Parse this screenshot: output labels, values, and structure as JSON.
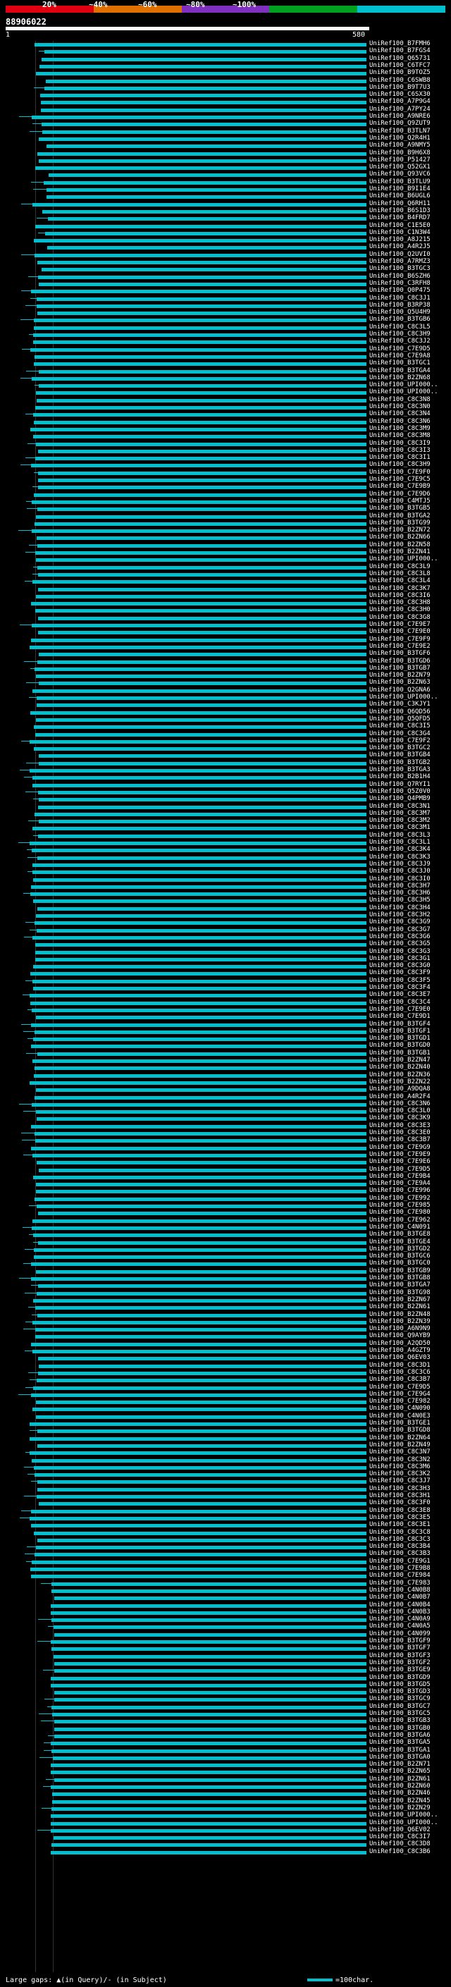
{
  "header": {
    "percent_labels": [
      "20%",
      "~40%",
      "~60%",
      "~80%",
      "~100%"
    ],
    "bar_colors": [
      "#e00010",
      "#e07000",
      "#8030c0",
      "#00a020",
      "#00c0d0"
    ],
    "query_id": "88906022",
    "ruler_start": "1",
    "ruler_end": "580"
  },
  "hits": [
    "UniRef100_B7FMH6",
    "UniRef100_B7FGS4",
    "UniRef100_Q65731",
    "UniRef100_C6TFC7",
    "UniRef100_B9TOZ5",
    "UniRef100_C6SWB8",
    "UniRef100_B9T7U3",
    "UniRef100_C6SX30",
    "UniRef100_A7P9G4",
    "UniRef100_A7PY24",
    "UniRef100_A9NRE6",
    "UniRef100_Q9ZUT9",
    "UniRef100_B3TLN7",
    "UniRef100_Q2R4H1",
    "UniRef100_A9NMY5",
    "UniRef100_B9H6X8",
    "UniRef100_P51427",
    "UniRef100_Q52GX1",
    "UniRef100_Q93VC6",
    "UniRef100_B3TLU9",
    "UniRef100_B9I1E4",
    "UniRef100_B6UGL6",
    "UniRef100_Q6RH11",
    "UniRef100_B6S1D3",
    "UniRef100_B4FRD7",
    "UniRef100_C1E5E0",
    "UniRef100_C1N3W4",
    "UniRef100_A8J215",
    "UniRef100_A4R2J5",
    "UniRef100_Q2UVI0",
    "UniRef100_A7RMZ3",
    "UniRef100_B3TGC3",
    "UniRef100_B6SZH6",
    "UniRef100_C3RFH8",
    "UniRef100_Q0P475",
    "UniRef100_C8C3J1",
    "UniRef100_B3RP38",
    "UniRef100_Q5U4H9",
    "UniRef100_B3TGB6",
    "UniRef100_C8C3L5",
    "UniRef100_C8C3H9",
    "UniRef100_C8C3J2",
    "UniRef100_C7E9D5",
    "UniRef100_C7E9A8",
    "UniRef100_B3TGC1",
    "UniRef100_B3TGA4",
    "UniRef100_B2ZN68",
    "UniRef100_UPI000..",
    "UniRef100_UPI000..",
    "UniRef100_C8C3N8",
    "UniRef100_C8C3N0",
    "UniRef100_C8C3N4",
    "UniRef100_C8C3N6",
    "UniRef100_C8C3M9",
    "UniRef100_C8C3M8",
    "UniRef100_C8C3I9",
    "UniRef100_C8C3I3",
    "UniRef100_C8C3I1",
    "UniRef100_C8C3H9",
    "UniRef100_C7E9F0",
    "UniRef100_C7E9C5",
    "UniRef100_C7E9B9",
    "UniRef100_C7E9D6",
    "UniRef100_C4MTJ5",
    "UniRef100_B3TGB5",
    "UniRef100_B3TGA2",
    "UniRef100_B3TG99",
    "UniRef100_B2ZN72",
    "UniRef100_B2ZN66",
    "UniRef100_B2ZN58",
    "UniRef100_B2ZN41",
    "UniRef100_UPI000..",
    "UniRef100_C8C3L9",
    "UniRef100_C8C3L8",
    "UniRef100_C8C3L4",
    "UniRef100_C8C3K7",
    "UniRef100_C8C3I6",
    "UniRef100_C8C3H8",
    "UniRef100_C8C3H0",
    "UniRef100_C8C3G8",
    "UniRef100_C7E9E7",
    "UniRef100_C7E9E0",
    "UniRef100_C7E9F9",
    "UniRef100_C7E9E2",
    "UniRef100_B3TGF6",
    "UniRef100_B3TGD6",
    "UniRef100_B3TGB7",
    "UniRef100_B2ZN79",
    "UniRef100_B2ZN63",
    "UniRef100_Q2GNA6",
    "UniRef100_UPI000..",
    "UniRef100_C3KJY1",
    "UniRef100_Q6QD56",
    "UniRef100_Q5QFD5",
    "UniRef100_C8C3I5",
    "UniRef100_C8C3G4",
    "UniRef100_C7E9F2",
    "UniRef100_B3TGC2",
    "UniRef100_B3TGB4",
    "UniRef100_B3TGB2",
    "UniRef100_B3TGA3",
    "UniRef100_B2B1H4",
    "UniRef100_Q7RYI1",
    "UniRef100_Q5Z0V0",
    "UniRef100_Q4PMB9",
    "UniRef100_C8C3N1",
    "UniRef100_C8C3M7",
    "UniRef100_C8C3M2",
    "UniRef100_C8C3M1",
    "UniRef100_C8C3L3",
    "UniRef100_C8C3L1",
    "UniRef100_C8C3K4",
    "UniRef100_C8C3K3",
    "UniRef100_C8C3J9",
    "UniRef100_C8C3J0",
    "UniRef100_C8C3I0",
    "UniRef100_C8C3H7",
    "UniRef100_C8C3H6",
    "UniRef100_C8C3H5",
    "UniRef100_C8C3H4",
    "UniRef100_C8C3H2",
    "UniRef100_C8C3G9",
    "UniRef100_C8C3G7",
    "UniRef100_C8C3G6",
    "UniRef100_C8C3G5",
    "UniRef100_C8C3G3",
    "UniRef100_C8C3G1",
    "UniRef100_C8C3G0",
    "UniRef100_C8C3F9",
    "UniRef100_C8C3F5",
    "UniRef100_C8C3F4",
    "UniRef100_C8C3E7",
    "UniRef100_C8C3C4",
    "UniRef100_C7E9E0",
    "UniRef100_C7E9D1",
    "UniRef100_B3TGF4",
    "UniRef100_B3TGF1",
    "UniRef100_B3TGD1",
    "UniRef100_B3TGD0",
    "UniRef100_B3TGB1",
    "UniRef100_B2ZN47",
    "UniRef100_B2ZN40",
    "UniRef100_B2ZN36",
    "UniRef100_B2ZN22",
    "UniRef100_A9DQA8",
    "UniRef100_A4R2F4",
    "UniRef100_C8C3N6",
    "UniRef100_C8C3L0",
    "UniRef100_C8C3K9",
    "UniRef100_C8C3E3",
    "UniRef100_C8C3E0",
    "UniRef100_C8C3B7",
    "UniRef100_C7E9G9",
    "UniRef100_C7E9E9",
    "UniRef100_C7E9E6",
    "UniRef100_C7E9D5",
    "UniRef100_C7E9B4",
    "UniRef100_C7E9A4",
    "UniRef100_C7E996",
    "UniRef100_C7E992",
    "UniRef100_C7E985",
    "UniRef100_C7E980",
    "UniRef100_C7E962",
    "UniRef100_C4N091",
    "UniRef100_B3TGE8",
    "UniRef100_B3TGE4",
    "UniRef100_B3TGD2",
    "UniRef100_B3TGC6",
    "UniRef100_B3TGC0",
    "UniRef100_B3TGB9",
    "UniRef100_B3TGB8",
    "UniRef100_B3TGA7",
    "UniRef100_B3TG98",
    "UniRef100_B2ZN67",
    "UniRef100_B2ZN61",
    "UniRef100_B2ZN48",
    "UniRef100_B2ZN39",
    "UniRef100_A6N9N9",
    "UniRef100_Q9AYB9",
    "UniRef100_A2QD50",
    "UniRef100_A4GZT9",
    "UniRef100_Q6EV03",
    "UniRef100_C8C3D1",
    "UniRef100_C8C3C6",
    "UniRef100_C8C3B7",
    "UniRef100_C7E9D5",
    "UniRef100_C7E9G4",
    "UniRef100_C7E982",
    "UniRef100_C4N090",
    "UniRef100_C4N0E3",
    "UniRef100_B3TGE1",
    "UniRef100_B3TGD8",
    "UniRef100_B2ZN64",
    "UniRef100_B2ZN49",
    "UniRef100_C8C3N7",
    "UniRef100_C8C3N2",
    "UniRef100_C8C3M6",
    "UniRef100_C8C3K2",
    "UniRef100_C8C3J7",
    "UniRef100_C8C3H3",
    "UniRef100_C8C3H1",
    "UniRef100_C8C3F0",
    "UniRef100_C8C3E8",
    "UniRef100_C8C3E5",
    "UniRef100_C8C3E1",
    "UniRef100_C8C3C8",
    "UniRef100_C8C3C3",
    "UniRef100_C8C3B4",
    "UniRef100_C8C3B3",
    "UniRef100_C7E9G1",
    "UniRef100_C7E9B8",
    "UniRef100_C7E984",
    "UniRef100_C7E983",
    "UniRef100_C4N0B8",
    "UniRef100_C4N0B7",
    "UniRef100_C4N0B4",
    "UniRef100_C4N0B3",
    "UniRef100_C4N0A9",
    "UniRef100_C4N0A5",
    "UniRef100_C4N099",
    "UniRef100_B3TGF9",
    "UniRef100_B3TGF7",
    "UniRef100_B3TGF3",
    "UniRef100_B3TGF2",
    "UniRef100_B3TGE9",
    "UniRef100_B3TGD9",
    "UniRef100_B3TGD5",
    "UniRef100_B3TGD3",
    "UniRef100_B3TGC9",
    "UniRef100_B3TGC7",
    "UniRef100_B3TGC5",
    "UniRef100_B3TGB3",
    "UniRef100_B3TGB0",
    "UniRef100_B3TGA6",
    "UniRef100_B3TGA5",
    "UniRef100_B3TGA1",
    "UniRef100_B3TGA0",
    "UniRef100_B2ZN71",
    "UniRef100_B2ZN65",
    "UniRef100_B2ZN61",
    "UniRef100_B2ZN60",
    "UniRef100_B2ZN46",
    "UniRef100_B2ZN45",
    "UniRef100_B2ZN29",
    "UniRef100_UPI000..",
    "UniRef100_UPI000..",
    "UniRef100_Q6EV02",
    "UniRef100_C8C3I7",
    "UniRef100_C8C3D8",
    "UniRef100_C8C3B6"
  ],
  "legend": {
    "text": "Large gaps: ▲(in Query)/- (in Subject)",
    "scale": "=100char."
  }
}
